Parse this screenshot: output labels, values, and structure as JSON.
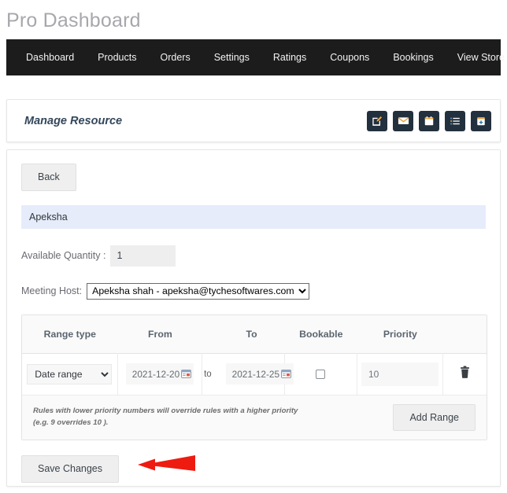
{
  "page": {
    "title": "Pro Dashboard"
  },
  "nav": {
    "items": [
      {
        "label": "Dashboard"
      },
      {
        "label": "Products"
      },
      {
        "label": "Orders"
      },
      {
        "label": "Settings"
      },
      {
        "label": "Ratings"
      },
      {
        "label": "Coupons"
      },
      {
        "label": "Bookings"
      },
      {
        "label": "View Store"
      }
    ]
  },
  "panel": {
    "title": "Manage Resource",
    "icons": [
      {
        "name": "edit-icon"
      },
      {
        "name": "envelope-icon"
      },
      {
        "name": "calendar-icon"
      },
      {
        "name": "list-icon"
      },
      {
        "name": "calendar-plus-icon"
      }
    ]
  },
  "form": {
    "back_label": "Back",
    "resource_name": "Apeksha",
    "quantity_label": "Available Quantity :",
    "quantity_value": "1",
    "host_label": "Meeting Host:",
    "host_value": "Apeksha shah - apeksha@tychesoftwares.com",
    "host_options": [
      "Apeksha shah - apeksha@tychesoftwares.com"
    ],
    "save_label": "Save Changes"
  },
  "table": {
    "headers": [
      {
        "label": "Range type"
      },
      {
        "label": "From"
      },
      {
        "label": "To"
      },
      {
        "label": "Bookable"
      },
      {
        "label": "Priority"
      }
    ],
    "rows": [
      {
        "range_type": "Date range",
        "range_type_options": [
          "Date range"
        ],
        "from": "2021-12-20",
        "separator": "to",
        "to": "2021-12-25",
        "bookable": false,
        "priority": "10",
        "delete_icon": "trash-icon"
      }
    ],
    "note": "Rules with lower priority numbers will override rules with a higher priority (e.g. 9 overrides 10 ).",
    "add_range_label": "Add Range"
  },
  "annotation": {
    "arrow_color": "#ee1b11",
    "arrow_direction": "left"
  },
  "colors": {
    "navbar_bg": "#1c1c1c",
    "icon_btn_bg": "#23303d",
    "banner_bg": "#e6ecfa",
    "accent_red": "#ee1b11"
  }
}
